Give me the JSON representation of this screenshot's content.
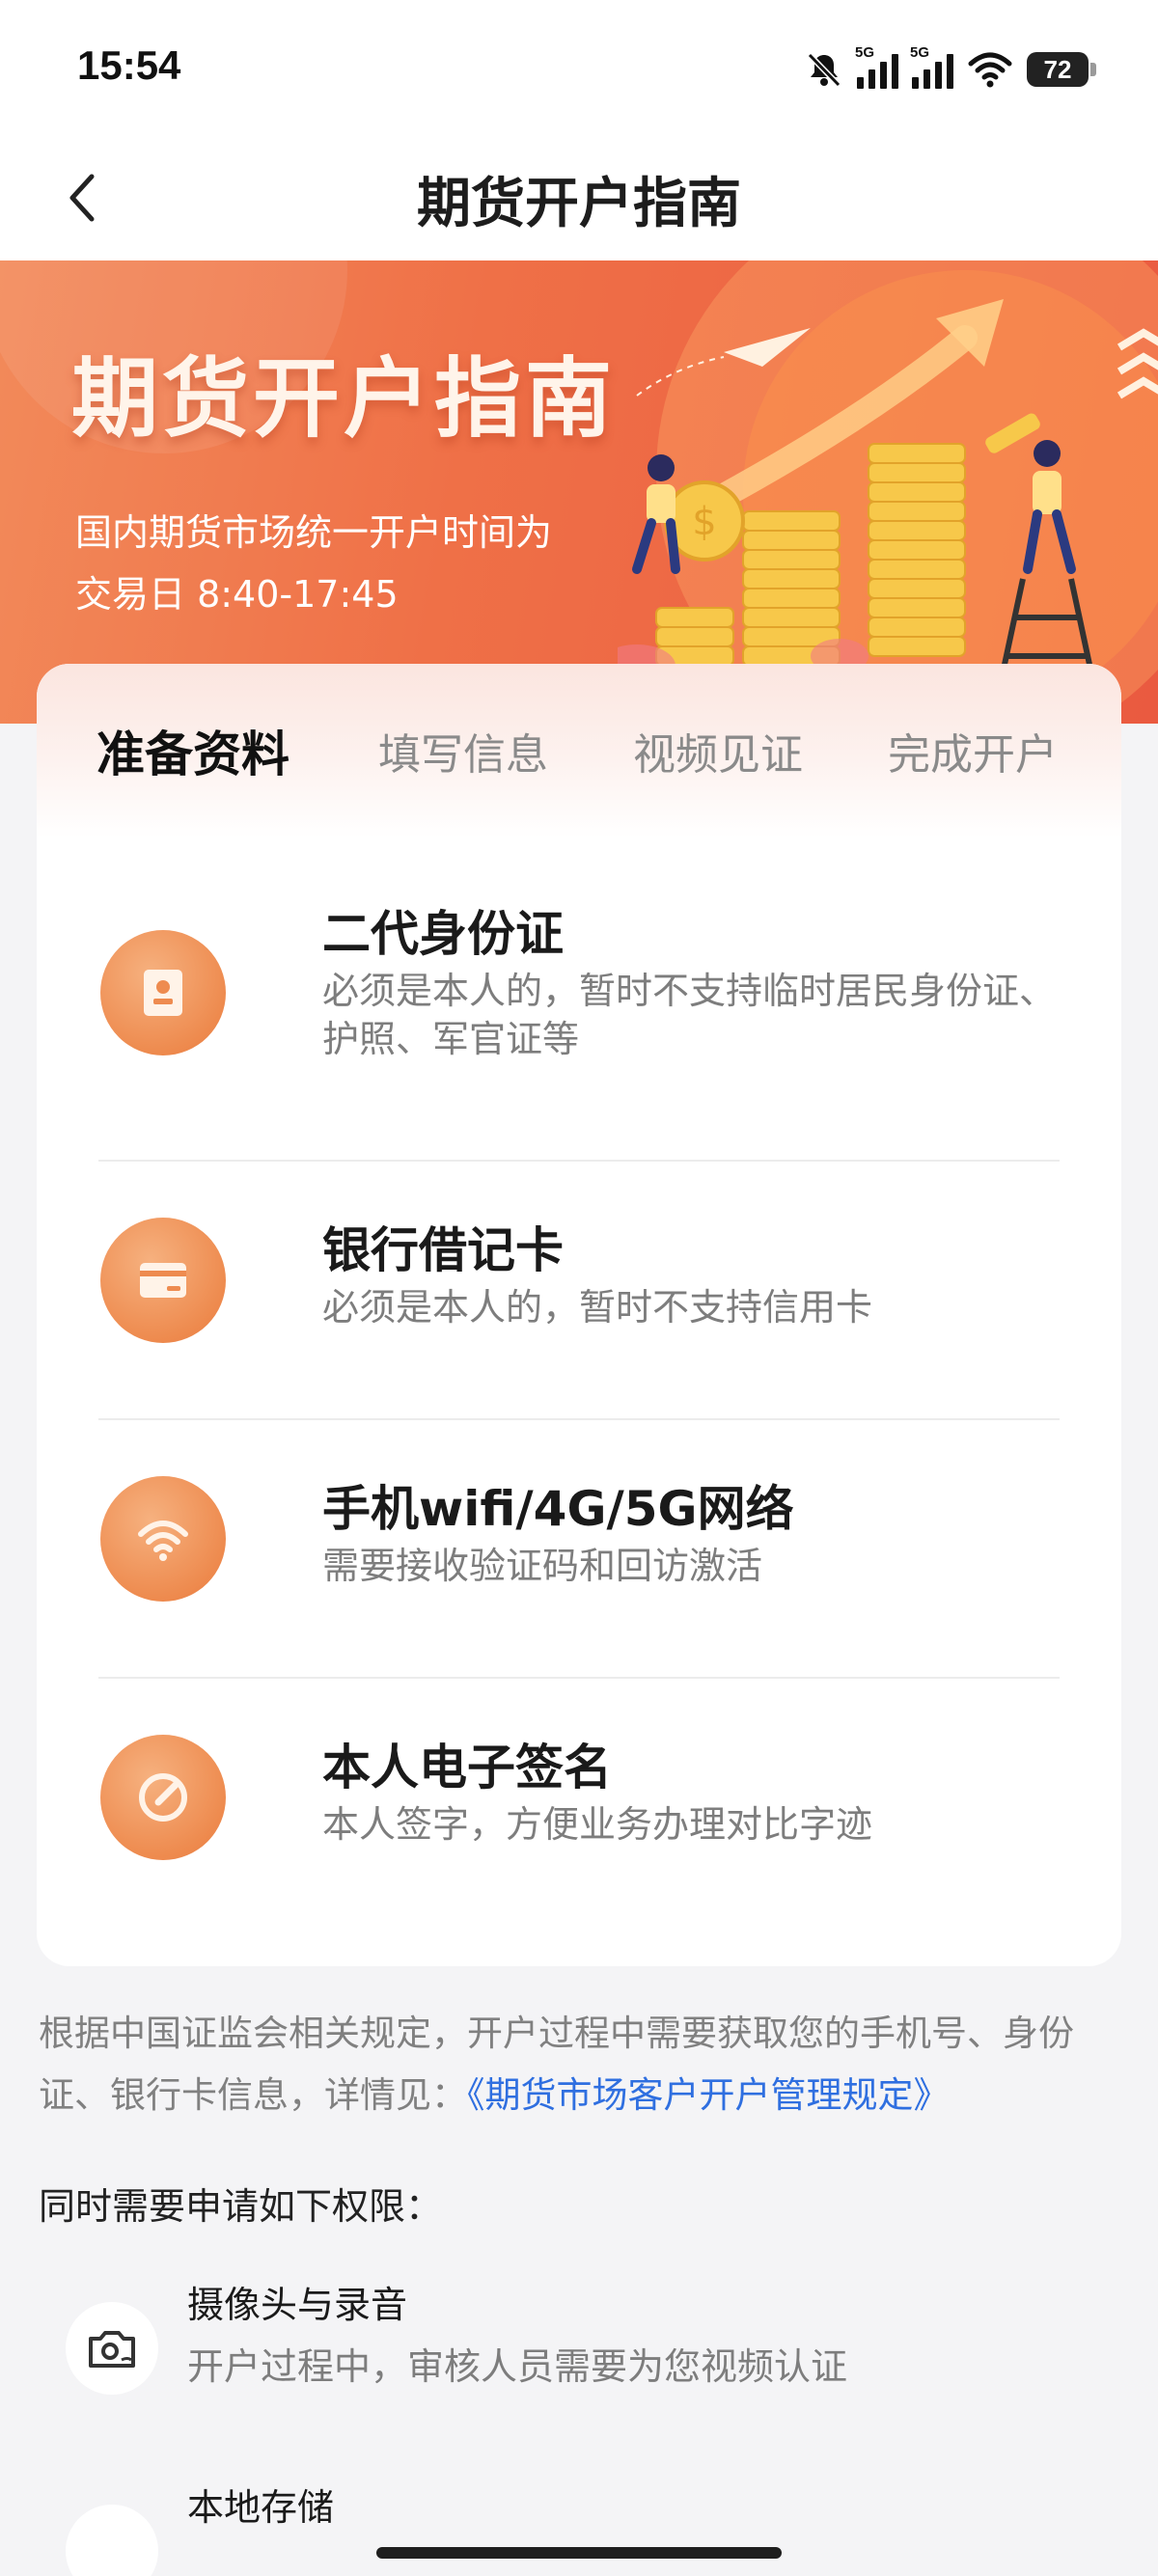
{
  "status_bar": {
    "time": "15:54",
    "battery": "72",
    "sim1": "5G",
    "sim2": "5G"
  },
  "header": {
    "title": "期货开户指南"
  },
  "banner": {
    "title": "期货开户指南",
    "subtitle_line1": "国内期货市场统一开户时间为",
    "subtitle_line2": "交易日 8:40-17:45"
  },
  "tabs": [
    {
      "label": "准备资料",
      "active": true
    },
    {
      "label": "填写信息",
      "active": false
    },
    {
      "label": "视频见证",
      "active": false
    },
    {
      "label": "完成开户",
      "active": false
    }
  ],
  "items": [
    {
      "icon": "id-card-icon",
      "title": "二代身份证",
      "desc": "必须是本人的，暂时不支持临时居民身份证、护照、军官证等"
    },
    {
      "icon": "bank-card-icon",
      "title": "银行借记卡",
      "desc": "必须是本人的，暂时不支持信用卡"
    },
    {
      "icon": "wifi-icon",
      "title": "手机wifi/4G/5G网络",
      "desc": "需要接收验证码和回访激活"
    },
    {
      "icon": "signature-icon",
      "title": "本人电子签名",
      "desc": "本人签字，方便业务办理对比字迹"
    }
  ],
  "notice": {
    "text": "根据中国证监会相关规定，开户过程中需要获取您的手机号、身份证、银行卡信息，详情见：",
    "link": "《期货市场客户开户管理规定》"
  },
  "permissions": {
    "heading": "同时需要申请如下权限：",
    "items": [
      {
        "icon": "camera-icon",
        "title": "摄像头与录音",
        "desc": "开户过程中，审核人员需要为您视频认证"
      },
      {
        "icon": "storage-icon",
        "title": "本地存储",
        "desc": ""
      }
    ]
  },
  "colors": {
    "accent": "#ef7047",
    "icon_orange": "#ee8b4f",
    "link": "#2f6fe0"
  }
}
